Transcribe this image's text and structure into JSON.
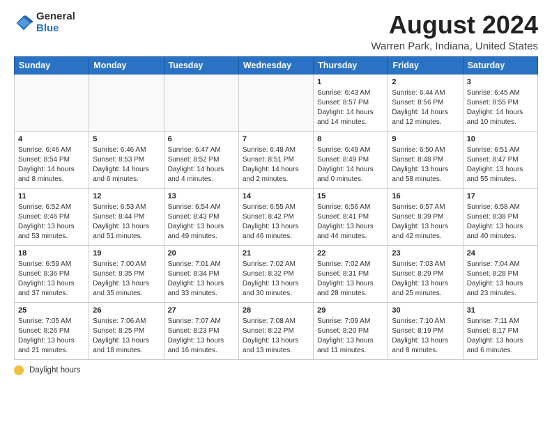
{
  "logo": {
    "general": "General",
    "blue": "Blue"
  },
  "title": "August 2024",
  "subtitle": "Warren Park, Indiana, United States",
  "days_of_week": [
    "Sunday",
    "Monday",
    "Tuesday",
    "Wednesday",
    "Thursday",
    "Friday",
    "Saturday"
  ],
  "legend_label": "Daylight hours",
  "weeks": [
    [
      {
        "day": "",
        "detail": ""
      },
      {
        "day": "",
        "detail": ""
      },
      {
        "day": "",
        "detail": ""
      },
      {
        "day": "",
        "detail": ""
      },
      {
        "day": "1",
        "detail": "Sunrise: 6:43 AM\nSunset: 8:57 PM\nDaylight: 14 hours\nand 14 minutes."
      },
      {
        "day": "2",
        "detail": "Sunrise: 6:44 AM\nSunset: 8:56 PM\nDaylight: 14 hours\nand 12 minutes."
      },
      {
        "day": "3",
        "detail": "Sunrise: 6:45 AM\nSunset: 8:55 PM\nDaylight: 14 hours\nand 10 minutes."
      }
    ],
    [
      {
        "day": "4",
        "detail": "Sunrise: 6:46 AM\nSunset: 8:54 PM\nDaylight: 14 hours\nand 8 minutes."
      },
      {
        "day": "5",
        "detail": "Sunrise: 6:46 AM\nSunset: 8:53 PM\nDaylight: 14 hours\nand 6 minutes."
      },
      {
        "day": "6",
        "detail": "Sunrise: 6:47 AM\nSunset: 8:52 PM\nDaylight: 14 hours\nand 4 minutes."
      },
      {
        "day": "7",
        "detail": "Sunrise: 6:48 AM\nSunset: 8:51 PM\nDaylight: 14 hours\nand 2 minutes."
      },
      {
        "day": "8",
        "detail": "Sunrise: 6:49 AM\nSunset: 8:49 PM\nDaylight: 14 hours\nand 0 minutes."
      },
      {
        "day": "9",
        "detail": "Sunrise: 6:50 AM\nSunset: 8:48 PM\nDaylight: 13 hours\nand 58 minutes."
      },
      {
        "day": "10",
        "detail": "Sunrise: 6:51 AM\nSunset: 8:47 PM\nDaylight: 13 hours\nand 55 minutes."
      }
    ],
    [
      {
        "day": "11",
        "detail": "Sunrise: 6:52 AM\nSunset: 8:46 PM\nDaylight: 13 hours\nand 53 minutes."
      },
      {
        "day": "12",
        "detail": "Sunrise: 6:53 AM\nSunset: 8:44 PM\nDaylight: 13 hours\nand 51 minutes."
      },
      {
        "day": "13",
        "detail": "Sunrise: 6:54 AM\nSunset: 8:43 PM\nDaylight: 13 hours\nand 49 minutes."
      },
      {
        "day": "14",
        "detail": "Sunrise: 6:55 AM\nSunset: 8:42 PM\nDaylight: 13 hours\nand 46 minutes."
      },
      {
        "day": "15",
        "detail": "Sunrise: 6:56 AM\nSunset: 8:41 PM\nDaylight: 13 hours\nand 44 minutes."
      },
      {
        "day": "16",
        "detail": "Sunrise: 6:57 AM\nSunset: 8:39 PM\nDaylight: 13 hours\nand 42 minutes."
      },
      {
        "day": "17",
        "detail": "Sunrise: 6:58 AM\nSunset: 8:38 PM\nDaylight: 13 hours\nand 40 minutes."
      }
    ],
    [
      {
        "day": "18",
        "detail": "Sunrise: 6:59 AM\nSunset: 8:36 PM\nDaylight: 13 hours\nand 37 minutes."
      },
      {
        "day": "19",
        "detail": "Sunrise: 7:00 AM\nSunset: 8:35 PM\nDaylight: 13 hours\nand 35 minutes."
      },
      {
        "day": "20",
        "detail": "Sunrise: 7:01 AM\nSunset: 8:34 PM\nDaylight: 13 hours\nand 33 minutes."
      },
      {
        "day": "21",
        "detail": "Sunrise: 7:02 AM\nSunset: 8:32 PM\nDaylight: 13 hours\nand 30 minutes."
      },
      {
        "day": "22",
        "detail": "Sunrise: 7:02 AM\nSunset: 8:31 PM\nDaylight: 13 hours\nand 28 minutes."
      },
      {
        "day": "23",
        "detail": "Sunrise: 7:03 AM\nSunset: 8:29 PM\nDaylight: 13 hours\nand 25 minutes."
      },
      {
        "day": "24",
        "detail": "Sunrise: 7:04 AM\nSunset: 8:28 PM\nDaylight: 13 hours\nand 23 minutes."
      }
    ],
    [
      {
        "day": "25",
        "detail": "Sunrise: 7:05 AM\nSunset: 8:26 PM\nDaylight: 13 hours\nand 21 minutes."
      },
      {
        "day": "26",
        "detail": "Sunrise: 7:06 AM\nSunset: 8:25 PM\nDaylight: 13 hours\nand 18 minutes."
      },
      {
        "day": "27",
        "detail": "Sunrise: 7:07 AM\nSunset: 8:23 PM\nDaylight: 13 hours\nand 16 minutes."
      },
      {
        "day": "28",
        "detail": "Sunrise: 7:08 AM\nSunset: 8:22 PM\nDaylight: 13 hours\nand 13 minutes."
      },
      {
        "day": "29",
        "detail": "Sunrise: 7:09 AM\nSunset: 8:20 PM\nDaylight: 13 hours\nand 11 minutes."
      },
      {
        "day": "30",
        "detail": "Sunrise: 7:10 AM\nSunset: 8:19 PM\nDaylight: 13 hours\nand 8 minutes."
      },
      {
        "day": "31",
        "detail": "Sunrise: 7:11 AM\nSunset: 8:17 PM\nDaylight: 13 hours\nand 6 minutes."
      }
    ]
  ]
}
